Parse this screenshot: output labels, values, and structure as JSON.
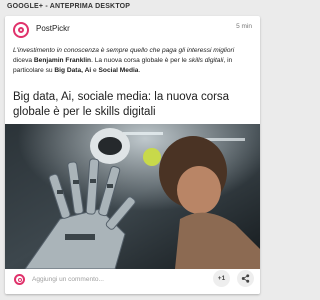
{
  "header": {
    "title": "GOOGLE+ - ANTEPRIMA DESKTOP"
  },
  "post": {
    "author": "PostPickr",
    "time": "5 min",
    "description": {
      "quote": "L'investimento in conoscenza è sempre quello che paga gli interessi migliori",
      "said": " diceva ",
      "person": "Benjamin Franklin",
      "mid": ". La nuova corsa globale è per le ",
      "skills": "skills digitali",
      "mid2": ", in particolare su ",
      "topics": "Big Data, Ai",
      "and": " e ",
      "social": "Social Media",
      "end": "."
    },
    "link_title": "Big data, Ai, sociale media: la nuova corsa globale è per le skills digitali",
    "image_icon": "robot-hand-photo"
  },
  "footer": {
    "comment_placeholder": "Aggiungi un commento...",
    "plus_one": "+1",
    "share_icon": "share-icon"
  },
  "colors": {
    "brand": "#e0326b",
    "background": "#ebebeb"
  }
}
